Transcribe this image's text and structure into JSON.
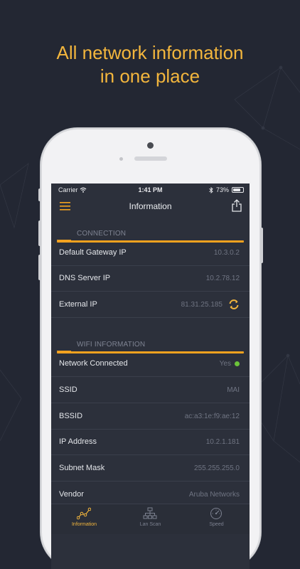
{
  "headline": {
    "line1": "All network information",
    "line2": "in one place"
  },
  "status_bar": {
    "carrier": "Carrier",
    "time": "1:41 PM",
    "battery": "73%"
  },
  "nav": {
    "title": "Information"
  },
  "sections": {
    "connection": {
      "title": "CONNECTION",
      "rows": [
        {
          "label": "Default Gateway IP",
          "value": "10.3.0.2"
        },
        {
          "label": "DNS Server IP",
          "value": "10.2.78.12"
        },
        {
          "label": "External IP",
          "value": "81.31.25.185"
        }
      ]
    },
    "wifi": {
      "title": "WIFI INFORMATION",
      "rows": [
        {
          "label": "Network Connected",
          "value": "Yes"
        },
        {
          "label": "SSID",
          "value": "MAI"
        },
        {
          "label": "BSSID",
          "value": "ac:a3:1e:f9:ae:12"
        },
        {
          "label": "IP Address",
          "value": "10.2.1.181"
        },
        {
          "label": "Subnet Mask",
          "value": "255.255.255.0"
        },
        {
          "label": "Vendor",
          "value": "Aruba Networks"
        }
      ]
    }
  },
  "tabs": [
    {
      "label": "Information",
      "icon": "graph-icon",
      "active": true
    },
    {
      "label": "Lan Scan",
      "icon": "network-icon",
      "active": false
    },
    {
      "label": "Speed",
      "icon": "speedometer-icon",
      "active": false
    }
  ],
  "colors": {
    "accent": "#f3a21f",
    "headline": "#f3b63d",
    "status_ok": "#6cc43a",
    "background": "#232733"
  }
}
